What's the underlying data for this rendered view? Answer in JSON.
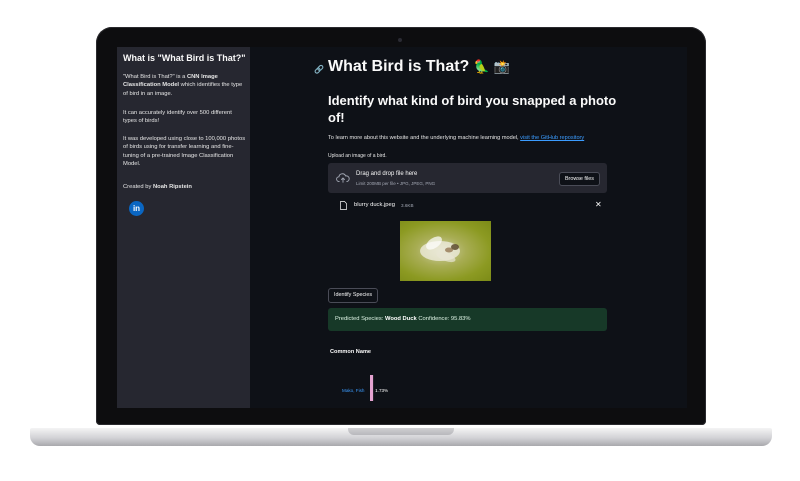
{
  "sidebar": {
    "title": "What is \"What Bird is That?\"",
    "intro_prefix": "\"What Bird is That?\" is a ",
    "intro_bold": "CNN Image Classification Model",
    "intro_suffix": " which identifies the type of bird in an image.",
    "accuracy": "It can accurately identify over 500 different types of birds!",
    "development": "It was developed using close to 100,000 photos of birds using for transfer learning and fine-tuning of a pre-trained Image Classification Model.",
    "created_by_prefix": "Created by ",
    "created_by_name": "Noah Ripstein",
    "linkedin_icon": "linkedin-icon",
    "linkedin_glyph": "in"
  },
  "main": {
    "title": "What Bird is That?",
    "title_emoji": "🦜 📸",
    "subtitle": "Identify what kind of bird you snapped a photo of!",
    "info_text": "To learn more about this website and the underlying machine learning model, ",
    "info_link": "visit the GitHub repository",
    "upload_label": "Upload an image of a bird.",
    "dropzone": {
      "title": "Drag and drop file here",
      "subtitle": "Limit 200MB per file • JPG, JPEG, PNG",
      "browse_label": "Browse files"
    },
    "file": {
      "name": "blurry duck.jpeg",
      "size": "3.6KB",
      "close_glyph": "✕"
    },
    "identify_label": "Identify Species",
    "result": {
      "prefix": "Predicted Species: ",
      "species": "Wood Duck",
      "confidence": " Confidence: 95.83%"
    },
    "table_header": "Common Name",
    "chart_row": {
      "label": "Mako, Fish",
      "value_label": "1.73%",
      "value": 1.73,
      "bar_color": "#e4a3d1"
    }
  },
  "colors": {
    "app_bg": "#0e1117",
    "sidebar_bg": "#262730",
    "success_bg": "#173928",
    "link": "#3b9cff"
  }
}
